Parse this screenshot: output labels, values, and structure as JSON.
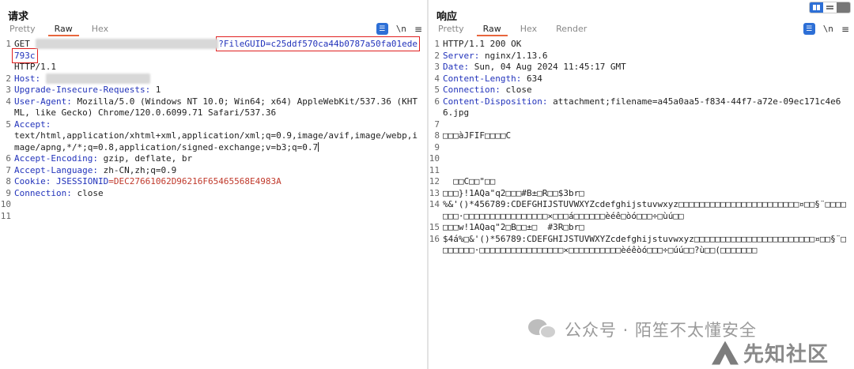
{
  "request": {
    "title": "请求",
    "tabs": [
      {
        "label": "Pretty",
        "active": false
      },
      {
        "label": "Raw",
        "active": true
      },
      {
        "label": "Hex",
        "active": false
      }
    ],
    "lines": [
      {
        "n": "1",
        "method": "GET",
        "path_highlight": "?FileGUID=c25ddf570ca44b0787a50fa01ede793c",
        "cont": "HTTP/1.1"
      },
      {
        "n": "2",
        "key": "Host:",
        "value": ""
      },
      {
        "n": "3",
        "key": "Upgrade-Insecure-Requests:",
        "value": " 1"
      },
      {
        "n": "4",
        "key": "User-Agent:",
        "value": " Mozilla/5.0 (Windows NT 10.0; Win64; x64) AppleWebKit/537.36 (KHTML, like Gecko) Chrome/120.0.6099.71 Safari/537.36"
      },
      {
        "n": "5",
        "key": "Accept:",
        "value": "text/html,application/xhtml+xml,application/xml;q=0.9,image/avif,image/webp,image/apng,*/*;q=0.8,application/signed-exchange;v=b3;q=0.7"
      },
      {
        "n": "6",
        "key": "Accept-Encoding:",
        "value": " gzip, deflate, br"
      },
      {
        "n": "7",
        "key": "Accept-Language:",
        "value": " zh-CN,zh;q=0.9"
      },
      {
        "n": "8",
        "key": "Cookie:",
        "cookie_name": "JSESSIONID",
        "cookie_value": "=DEC27661062D96216F65465568E4983A"
      },
      {
        "n": "9",
        "key": "Connection:",
        "value": " close"
      },
      {
        "n": "10"
      },
      {
        "n": "11"
      }
    ]
  },
  "response": {
    "title": "响应",
    "tabs": [
      {
        "label": "Pretty",
        "active": false
      },
      {
        "label": "Raw",
        "active": true
      },
      {
        "label": "Hex",
        "active": false
      },
      {
        "label": "Render",
        "active": false
      }
    ],
    "lines": [
      {
        "n": "1",
        "text": "HTTP/1.1 200 OK"
      },
      {
        "n": "2",
        "key": "Server:",
        "value": " nginx/1.13.6"
      },
      {
        "n": "3",
        "key": "Date:",
        "value": " Sun, 04 Aug 2024 11:45:17 GMT"
      },
      {
        "n": "4",
        "key": "Content-Length:",
        "value": " 634"
      },
      {
        "n": "5",
        "key": "Connection:",
        "value": " close"
      },
      {
        "n": "6",
        "key": "Content-Disposition:",
        "value": " attachment;filename=a45a0aa5-f834-44f7-a72e-09ec171c4e66.jpg"
      },
      {
        "n": "7",
        "text": ""
      },
      {
        "n": "8",
        "text": "□□□àJFIF□□□□C"
      },
      {
        "n": "9",
        "text": ""
      },
      {
        "n": "10",
        "text": ""
      },
      {
        "n": "11",
        "text": ""
      },
      {
        "n": "12",
        "text": "  □□C□□\"□□"
      },
      {
        "n": "13",
        "text": "□□□}!1AQa\"q2□□□#B±□R□□$3br□"
      },
      {
        "n": "14",
        "text": "%&'()*456789:CDEFGHIJSTUVWXYZcdefghijstuvwxyz□□□□□□□□□□□□□□□□□□□□□□□¤□□§¨□□□□□□□·□□□□□□□□□□□□□□□□×□□□á□□□□□□èéê□òó□□□÷□ùú□□"
      },
      {
        "n": "15",
        "text": "□□□w!1AQaq\"2□B□□±□  #3R□br□"
      },
      {
        "n": "16",
        "text": "$4á%□&'()*56789:CDEFGHIJSTUVWXYZcdefghijstuvwxyz□□□□□□□□□□□□□□□□□□□□□□□¤□□§¨□□□□□□□·□□□□□□□□□□□□□□□□×□□□□□□□□□□èéêòó□□□÷□úú□□?ù□□(□□□□□□□"
      }
    ]
  },
  "watermark": {
    "text": "公众号 · 陌笙不太懂安全",
    "logo_text": "先知社区"
  },
  "icons": {
    "wrap": "wrap-lines-icon",
    "newline": "\\n",
    "menu": "menu-icon"
  }
}
